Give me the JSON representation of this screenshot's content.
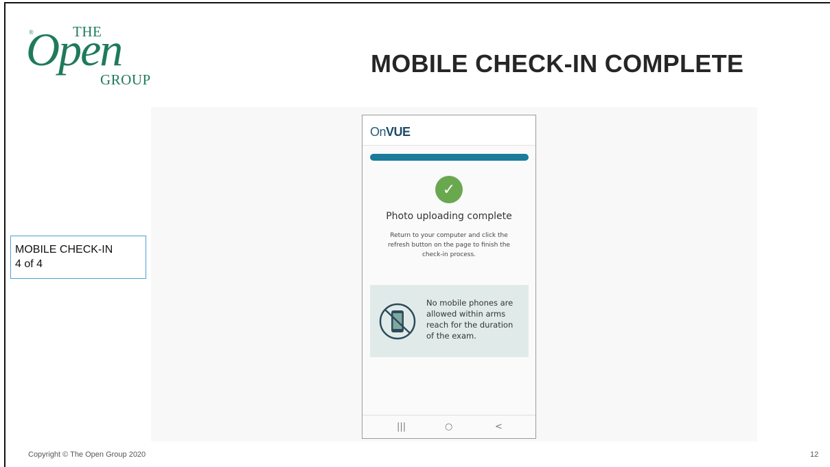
{
  "logo": {
    "reg": "®",
    "the": "THE",
    "open": "Open",
    "group": "GROUP"
  },
  "slide": {
    "title": "MOBILE CHECK-IN COMPLETE",
    "step_line1": "MOBILE CHECK-IN",
    "step_line2": "4 of 4",
    "copyright": "Copyright © The Open Group 2020",
    "page_number": "12"
  },
  "phone": {
    "app_logo_prefix": "On",
    "app_logo_suffix": "VUE",
    "progress_fraction": 1.0,
    "status_icon": "check-icon",
    "status_title": "Photo uploading complete",
    "instructions": "Return to your computer and click the refresh button on the page to finish the check-in process.",
    "warning_icon": "no-mobile-phone-icon",
    "warning_text": "No mobile phones are allowed within arms reach for the duration of the exam.",
    "nav": {
      "recents": "|||",
      "home": "○",
      "back": "<"
    }
  },
  "colors": {
    "brand_green": "#1f7a5c",
    "progress": "#1a7b9b",
    "success": "#6aa84f",
    "step_box_border": "#4a9fd4"
  }
}
